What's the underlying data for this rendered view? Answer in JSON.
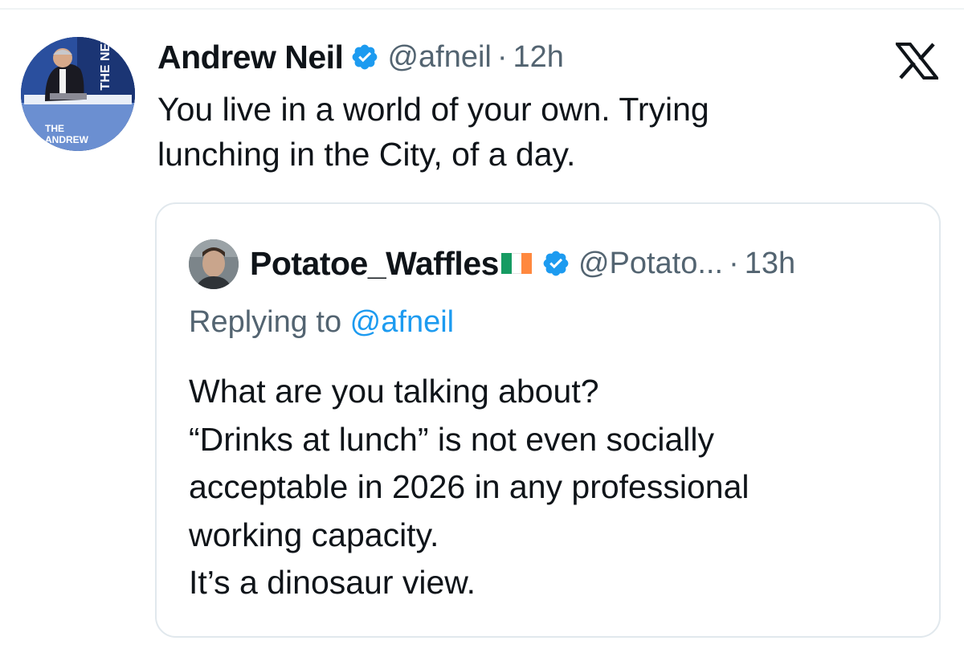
{
  "tweet": {
    "author_name": "Andrew Neil",
    "handle": "@afneil",
    "separator": "·",
    "time": "12h",
    "text_lines": [
      "You live in a world of your own. Trying",
      "lunching in the City, of a day."
    ],
    "avatar_text": {
      "top_banner": "THE NEIL",
      "bottom_banner_line1": "THE",
      "bottom_banner_line2": "ANDREW"
    }
  },
  "quoted_tweet": {
    "author_name": "Potatoe_Waffles",
    "flag": "Ireland",
    "handle": "@Potato...",
    "separator": "·",
    "time": "13h",
    "replying_prefix": "Replying to ",
    "replying_to": "@afneil",
    "text_lines": [
      "What are you talking about?",
      "“Drinks at lunch” is not even socially",
      "acceptable in 2026 in any professional",
      "working capacity.",
      "It’s a dinosaur view."
    ]
  },
  "icons": {
    "verified": "verified-badge-icon",
    "platform": "x-logo-icon"
  },
  "colors": {
    "verified_blue": "#1d9bf0",
    "text_primary": "#0f1419",
    "text_secondary": "#536471",
    "border": "#e1e8ed",
    "flag_green": "#169b62",
    "flag_white": "#ffffff",
    "flag_orange": "#ff883e"
  }
}
